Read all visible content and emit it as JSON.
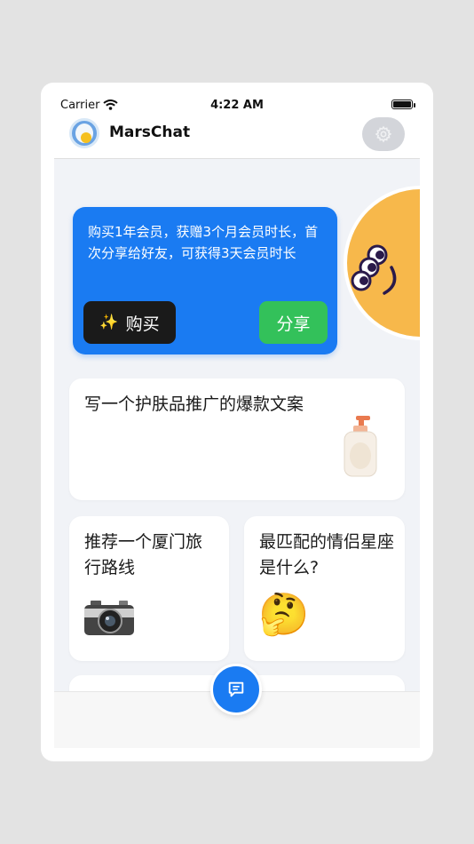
{
  "status_bar": {
    "carrier": "Carrier",
    "time": "4:22 AM"
  },
  "header": {
    "app_title": "MarsChat",
    "settings_icon": "gear-icon",
    "logo_icon": "egg-logo-icon"
  },
  "promo": {
    "text": "购买1年会员，获赠3个月会员时长，首次分享给好友，可获得3天会员时长",
    "buy_icon": "✨",
    "buy_label": "购买",
    "share_label": "分享",
    "mascot_icon": "three-eyed-mascot-icon"
  },
  "prompts": [
    {
      "text": "写一个护肤品推广的爆款文案",
      "icon": "lotion-bottle-icon"
    },
    {
      "text": "推荐一个厦门旅行路线",
      "icon": "camera-icon"
    },
    {
      "text": "最匹配的情侣星座是什么?",
      "icon": "🤔"
    }
  ],
  "chat_button_icon": "chat-bubble-icon",
  "colors": {
    "accent": "#1a7bf2",
    "share": "#33c15a",
    "buy": "#1a1a1a",
    "mascot": "#f7b84b"
  }
}
